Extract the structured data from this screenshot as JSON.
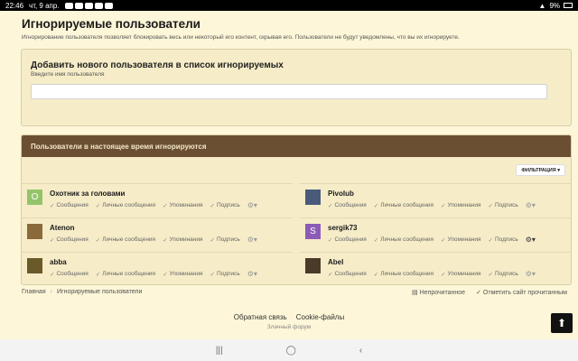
{
  "status": {
    "time": "22:46",
    "date": "чт, 9 апр.",
    "battery": "9%"
  },
  "page": {
    "title": "Игнорируемые пользователи",
    "description": "Игнорирование пользователя позволяет блокировать весь или некоторый его контент, скрывая его. Пользователи не будут уведомлены, что вы их игнорируете."
  },
  "add": {
    "title": "Добавить нового пользователя в список игнорируемых",
    "hint": "Введите имя пользователя",
    "placeholder": ""
  },
  "list": {
    "header": "Пользователи в настоящее время игнорируются",
    "filter_label": "ФИЛЬТРАЦИЯ ▾",
    "option_labels": [
      "Сообщения",
      "Личные сообщения",
      "Упоминания",
      "Подпись"
    ],
    "users": [
      {
        "name": "Охотник за головами",
        "avatar_letter": "О",
        "avatar_color": "#94c46a"
      },
      {
        "name": "Pivolub",
        "avatar_letter": "",
        "avatar_color": "#4a5a7a"
      },
      {
        "name": "Atenon",
        "avatar_letter": "",
        "avatar_color": "#8a6a3a"
      },
      {
        "name": "sergik73",
        "avatar_letter": "S",
        "avatar_color": "#8c5bb8"
      },
      {
        "name": "abba",
        "avatar_letter": "",
        "avatar_color": "#6a5a2a"
      },
      {
        "name": "Abel",
        "avatar_letter": "",
        "avatar_color": "#4a3a2a"
      }
    ]
  },
  "breadcrumb": {
    "home": "Главная",
    "current": "Игнорируемые пользователи"
  },
  "actions": {
    "unread": "Непрочитанное",
    "mark_read": "Отметить сайт прочитанным"
  },
  "footer": {
    "feedback": "Обратная связь",
    "cookies": "Cookie-файлы",
    "forum": "Злачный форум"
  }
}
